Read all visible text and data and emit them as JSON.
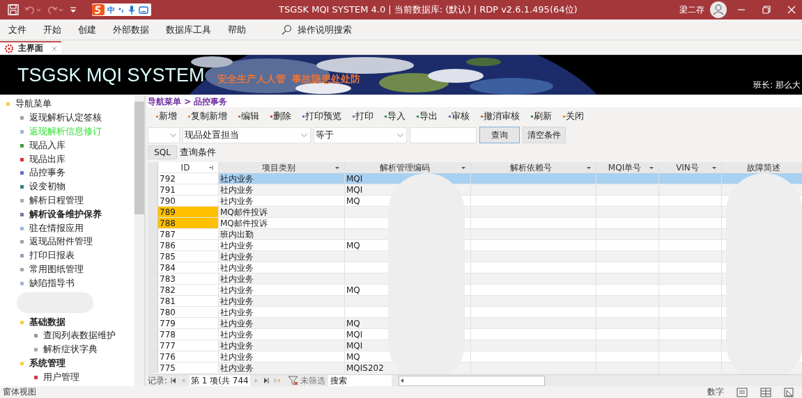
{
  "window": {
    "title": "TSGSK MQI SYSTEM 4.0 | 当前数据库: (默认) | RDP v2.6.1.495(64位)",
    "user": "梁二存",
    "ime": {
      "lang": "中"
    }
  },
  "menu": [
    "文件",
    "开始",
    "创建",
    "外部数据",
    "数据库工具",
    "帮助"
  ],
  "tell_me": "操作说明搜索",
  "doc_tabs": [
    {
      "label": "主界面",
      "selected": true
    }
  ],
  "banner": {
    "title": "TSGSK MQI SYSTEM",
    "slogan": "安全生产人人管  事故隐患处处防",
    "leader": "班长: 那么大"
  },
  "nav": {
    "label": "导航菜单",
    "bold": false,
    "selected": false,
    "color": "#f5d040",
    "children": [
      {
        "label": "返现解析认定签核",
        "bold": false,
        "selected": false,
        "color": "#9aa89a"
      },
      {
        "label": "返现解析信息修订",
        "bold": false,
        "selected": true,
        "color": "#a0b4d8"
      },
      {
        "label": "现品入库",
        "bold": false,
        "selected": false,
        "color": "#40a040"
      },
      {
        "label": "现品出库",
        "bold": false,
        "selected": false,
        "color": "#e03030"
      },
      {
        "label": "品控事务",
        "bold": false,
        "selected": false,
        "color": "#6070d0"
      },
      {
        "label": "设变初物",
        "bold": false,
        "selected": false,
        "color": "#308080"
      },
      {
        "label": "解析日程管理",
        "bold": false,
        "selected": false,
        "color": "#a0b0a0"
      },
      {
        "label": "解析设备维护保养",
        "bold": true,
        "selected": false,
        "color": "#8070a0"
      },
      {
        "label": "驻在情报应用",
        "bold": false,
        "selected": false,
        "color": "#a0b8e0"
      },
      {
        "label": "返现品附件管理",
        "bold": false,
        "selected": false,
        "color": "#a0a8a0"
      },
      {
        "label": "打印日报表",
        "bold": false,
        "selected": false,
        "color": "#90a0c0"
      },
      {
        "label": "常用图纸管理",
        "bold": false,
        "selected": false,
        "color": "#a0a8a0"
      },
      {
        "label": "缺陷指导书",
        "bold": false,
        "selected": false,
        "color": "#a0b4d8"
      },
      {
        "kind": "redacted"
      },
      {
        "label": "基础数据",
        "bold": true,
        "selected": false,
        "color": "#f5d040",
        "children": [
          {
            "label": "查阅列表数据维护",
            "bold": false,
            "selected": false,
            "color": "#909890"
          },
          {
            "label": "解析症状字典",
            "bold": false,
            "selected": false,
            "color": "#a0b0a0"
          }
        ]
      },
      {
        "label": "系统管理",
        "bold": true,
        "selected": false,
        "color": "#f5d040",
        "children": [
          {
            "label": "用户管理",
            "bold": false,
            "selected": false,
            "color": "#d04040"
          }
        ]
      }
    ]
  },
  "breadcrumb": "导航菜单 > 品控事务",
  "toolbar": [
    {
      "label": "新增",
      "color": "#d09050"
    },
    {
      "label": "复制新增",
      "color": "#d09050"
    },
    {
      "label": "编辑",
      "color": "#c07040"
    },
    {
      "label": "删除",
      "color": "#e03030"
    },
    {
      "label": "打印预览",
      "color": "#5070c0"
    },
    {
      "label": "打印",
      "color": "#7080a0"
    },
    {
      "label": "导入",
      "color": "#309050"
    },
    {
      "label": "导出",
      "color": "#309050"
    },
    {
      "label": "审核",
      "color": "#5070c0"
    },
    {
      "label": "撤消审核",
      "color": "#c07040"
    },
    {
      "label": "刷新",
      "color": "#309050"
    },
    {
      "label": "关闭",
      "color": "#e09020"
    }
  ],
  "filter": {
    "field": "现品处置担当",
    "operator": "等于",
    "query_button": "查询",
    "clear_button": "清空条件"
  },
  "sql": {
    "button": "SQL",
    "label": "查询条件"
  },
  "table": {
    "columns": [
      "ID",
      "项目类别",
      "解析管理编码",
      "解析依赖号",
      "MQI单号",
      "VIN号",
      "故障简述"
    ],
    "rows": [
      {
        "id": "792",
        "category": "社内业务",
        "code": "MQI",
        "selected": true,
        "flagged": false
      },
      {
        "id": "791",
        "category": "社内业务",
        "code": "MQI",
        "selected": false,
        "flagged": false
      },
      {
        "id": "790",
        "category": "社内业务",
        "code": "MQ",
        "selected": false,
        "flagged": false
      },
      {
        "id": "789",
        "category": "MQ邮件投诉",
        "selected": false,
        "flagged": true
      },
      {
        "id": "788",
        "category": "MQ邮件投诉",
        "selected": false,
        "flagged": true
      },
      {
        "id": "787",
        "category": "班内出勤",
        "selected": false,
        "flagged": false
      },
      {
        "id": "786",
        "category": "社内业务",
        "code": "MQ",
        "selected": false,
        "flagged": false
      },
      {
        "id": "785",
        "category": "社内业务",
        "selected": false,
        "flagged": false
      },
      {
        "id": "784",
        "category": "社内业务",
        "selected": false,
        "flagged": false
      },
      {
        "id": "783",
        "category": "社内业务",
        "selected": false,
        "flagged": false
      },
      {
        "id": "782",
        "category": "社内业务",
        "code": "MQ",
        "selected": false,
        "flagged": false
      },
      {
        "id": "781",
        "category": "社内业务",
        "selected": false,
        "flagged": false
      },
      {
        "id": "780",
        "category": "社内业务",
        "selected": false,
        "flagged": false
      },
      {
        "id": "779",
        "category": "社内业务",
        "code": "MQ",
        "selected": false,
        "flagged": false
      },
      {
        "id": "778",
        "category": "社内业务",
        "code": "MQI",
        "selected": false,
        "flagged": false
      },
      {
        "id": "777",
        "category": "社内业务",
        "code": "MQI",
        "selected": false,
        "flagged": false
      },
      {
        "id": "776",
        "category": "社内业务",
        "code": "MQ",
        "selected": false,
        "flagged": false
      },
      {
        "id": "775",
        "category": "社内业务",
        "code": "MQIS202",
        "selected": false,
        "flagged": false
      }
    ]
  },
  "record_nav": {
    "label": "记录:",
    "position": "第 1 项(共 744",
    "filter": "未筛选",
    "search": "搜索"
  },
  "status_bar": {
    "left": "窗体视图",
    "mode": "数字"
  }
}
